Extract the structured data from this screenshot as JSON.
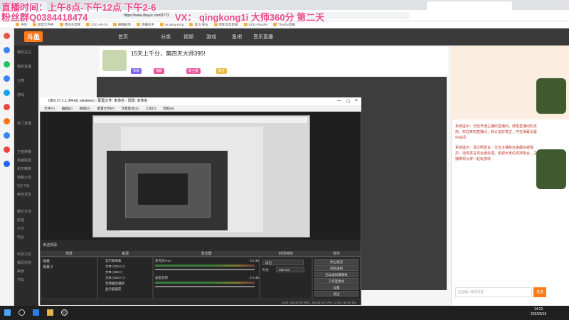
{
  "overlay": {
    "line1": "直播时间：上午8点-下午12点 下午2-6",
    "line2": "粉丝群Q0384418474",
    "line3": "VX： qingkong1i   大师360分 第二天"
  },
  "browser": {
    "url": "https://www.douyu.com/5772",
    "bookmarks": [
      "书签",
      "新建文件夹",
      "博主主官网",
      "2022-06-29",
      "播播剧场",
      "弹幕助手",
      "ss iqing kong",
      "亚马 果与",
      "智能消息客服",
      "EDG-Flandre",
      "Theshy直播"
    ]
  },
  "douyu": {
    "logo": "斗鱼",
    "nav": [
      "首页",
      "分类",
      "视频",
      "游戏",
      "鱼吧",
      "音乐直播"
    ],
    "sidebar": [
      "我的关注",
      "我的直播",
      "分类",
      "游戏",
      "热门直播",
      "王者荣耀",
      "英雄联盟",
      "和平精英",
      "穿越火线",
      "QQ飞车",
      "绝地求生",
      "娱乐天地",
      "颜值",
      "户外",
      "电台",
      "科技文化",
      "数码科技",
      "美食",
      "汽车"
    ],
    "room_title": "15天上千分，第四天大师395!",
    "tags": [
      "荣耀",
      "嗨聊",
      "新主播",
      "最佳"
    ],
    "chat_messages": [
      "系统提示：已经开通主播的直播间，感谢直播间的支持，欢迎来到直播间，默认友好发言，可在弹幕设置中关闭",
      "系统提示：请文明发言，无论主播和玩家都会被保护，违规发言将会被处理，谢谢大家的支持配合，主播带领大家一起玩游戏"
    ],
    "chat_placeholder": "这里输入聊天内容",
    "chat_send": "发送"
  },
  "obs": {
    "title": "OBS 27.1.1 (64-bit, windows) - 配置文件: 未命名 - 场景: 未命名",
    "menu": [
      "文件(F)",
      "编辑(E)",
      "视图(V)",
      "配置文件(P)",
      "场景集合(S)",
      "工具(T)",
      "帮助(H)"
    ],
    "source_label": "未选择源",
    "panels": [
      "场景",
      "来源",
      "混音器",
      "转场特效",
      "控件"
    ],
    "scenes": [
      "场景",
      "场景 2"
    ],
    "sources": [
      "显示器采集",
      "文本 (GDI+) 2",
      "文本 (GDI+)",
      "文本 (GDI+) 3",
      "音频输出捕获",
      "显示器捕获"
    ],
    "mixer": [
      {
        "name": "麦克风/Aux",
        "db": "0.0 dB"
      },
      {
        "name": "桌面音频",
        "db": "0.0 dB"
      }
    ],
    "transition": {
      "type": "淡出",
      "duration_label": "时长",
      "duration": "300 ms"
    },
    "controls": [
      "停止推流",
      "开始录制",
      "启动虚拟摄像机",
      "工作室模式",
      "设置",
      "退出"
    ],
    "status": "LIVE: 00:00:00   REC: 00:00:00   CPU: 1.0%, 60.00 fps"
  },
  "taskbar": {
    "time": "14:23",
    "date": "2022/6/16"
  }
}
